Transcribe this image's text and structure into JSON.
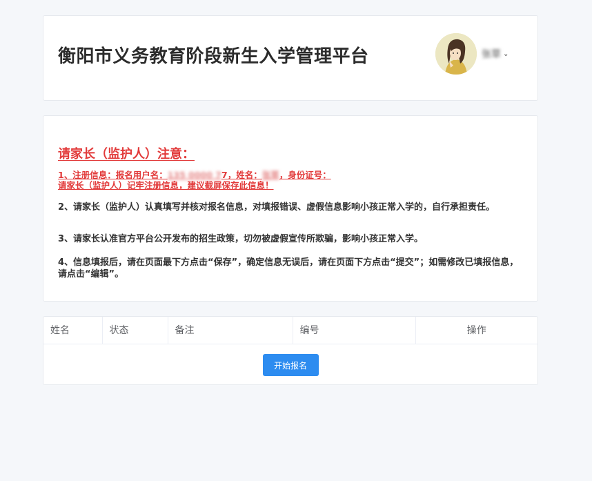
{
  "header": {
    "title": "衡阳市义务教育阶段新生入学管理平台",
    "user_name": "张草",
    "chevron": "⌄"
  },
  "notice": {
    "title": "请家长（监护人）注意：",
    "item1_prefix": "1、注册信息：报名用户名：",
    "item1_blur1": "135  0000 7",
    "item1_mid": "7，姓名：",
    "item1_blur2": "张草",
    "item1_suffix": "，身份证号：",
    "item1_line2": "请家长（监护人）记牢注册信息，建议截屏保存此信息！",
    "item2": "2、请家长（监护人）认真填写并核对报名信息，对填报错误、虚假信息影响小孩正常入学的，自行承担责任。",
    "item3": "3、请家长认准官方平台公开发布的招生政策，切勿被虚假宣传所欺骗，影响小孩正常入学。",
    "item4": "4、信息填报后，请在页面最下方点击“保存”，确定信息无误后，请在页面下方点击“提交”；如需修改已填报信息，请点击“编辑”。"
  },
  "table": {
    "headers": [
      "姓名",
      "状态",
      "备注",
      "编号",
      "操作"
    ],
    "start_button": "开始报名"
  },
  "colors": {
    "accent": "#2d8cf0",
    "warning_red": "#e23a3a",
    "background": "#f5f7fa"
  }
}
